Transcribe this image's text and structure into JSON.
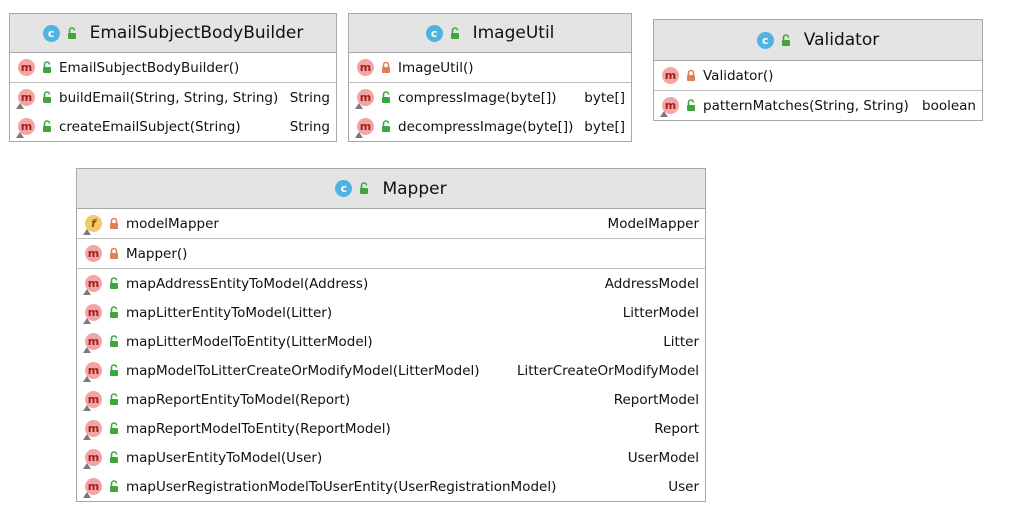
{
  "colors": {
    "header_bg": "#e4e4e4",
    "border": "#a9a9a9",
    "class_badge": "#4fb5e0",
    "method_badge": "#f5a4a4",
    "field_badge": "#f5c86a",
    "public_icon": "#3fa63f",
    "private_icon": "#e0805a"
  },
  "classes": [
    {
      "name": "EmailSubjectBodyBuilder",
      "badge": "c",
      "visibility": "public",
      "sections": [
        [
          {
            "badge": "m",
            "visibility": "public",
            "name": "EmailSubjectBodyBuilder()",
            "type": "",
            "override_marker": false
          }
        ],
        [
          {
            "badge": "m",
            "visibility": "public",
            "name": "buildEmail(String, String, String)",
            "type": "String",
            "override_marker": true
          },
          {
            "badge": "m",
            "visibility": "public",
            "name": "createEmailSubject(String)",
            "type": "String",
            "override_marker": true
          }
        ]
      ]
    },
    {
      "name": "ImageUtil",
      "badge": "c",
      "visibility": "public",
      "sections": [
        [
          {
            "badge": "m",
            "visibility": "private",
            "name": "ImageUtil()",
            "type": "",
            "override_marker": false
          }
        ],
        [
          {
            "badge": "m",
            "visibility": "public",
            "name": "compressImage(byte[])",
            "type": "byte[]",
            "override_marker": true
          },
          {
            "badge": "m",
            "visibility": "public",
            "name": "decompressImage(byte[])",
            "type": "byte[]",
            "override_marker": true
          }
        ]
      ]
    },
    {
      "name": "Validator",
      "badge": "c",
      "visibility": "public",
      "sections": [
        [
          {
            "badge": "m",
            "visibility": "private",
            "name": "Validator()",
            "type": "",
            "override_marker": false
          }
        ],
        [
          {
            "badge": "m",
            "visibility": "public",
            "name": "patternMatches(String, String)",
            "type": "boolean",
            "override_marker": true
          }
        ]
      ]
    },
    {
      "name": "Mapper",
      "badge": "c",
      "visibility": "public",
      "sections": [
        [
          {
            "badge": "f",
            "visibility": "private",
            "name": "modelMapper",
            "type": "ModelMapper",
            "override_marker": true
          }
        ],
        [
          {
            "badge": "m",
            "visibility": "private",
            "name": "Mapper()",
            "type": "",
            "override_marker": false
          }
        ],
        [
          {
            "badge": "m",
            "visibility": "public",
            "name": "mapAddressEntityToModel(Address)",
            "type": "AddressModel",
            "override_marker": true
          },
          {
            "badge": "m",
            "visibility": "public",
            "name": "mapLitterEntityToModel(Litter)",
            "type": "LitterModel",
            "override_marker": true
          },
          {
            "badge": "m",
            "visibility": "public",
            "name": "mapLitterModelToEntity(LitterModel)",
            "type": "Litter",
            "override_marker": true
          },
          {
            "badge": "m",
            "visibility": "public",
            "name": "mapModelToLitterCreateOrModifyModel(LitterModel)",
            "type": "LitterCreateOrModifyModel",
            "override_marker": true
          },
          {
            "badge": "m",
            "visibility": "public",
            "name": "mapReportEntityToModel(Report)",
            "type": "ReportModel",
            "override_marker": true
          },
          {
            "badge": "m",
            "visibility": "public",
            "name": "mapReportModelToEntity(ReportModel)",
            "type": "Report",
            "override_marker": true
          },
          {
            "badge": "m",
            "visibility": "public",
            "name": "mapUserEntityToModel(User)",
            "type": "UserModel",
            "override_marker": true
          },
          {
            "badge": "m",
            "visibility": "public",
            "name": "mapUserRegistrationModelToUserEntity(UserRegistrationModel)",
            "type": "User",
            "override_marker": true
          }
        ]
      ]
    }
  ]
}
